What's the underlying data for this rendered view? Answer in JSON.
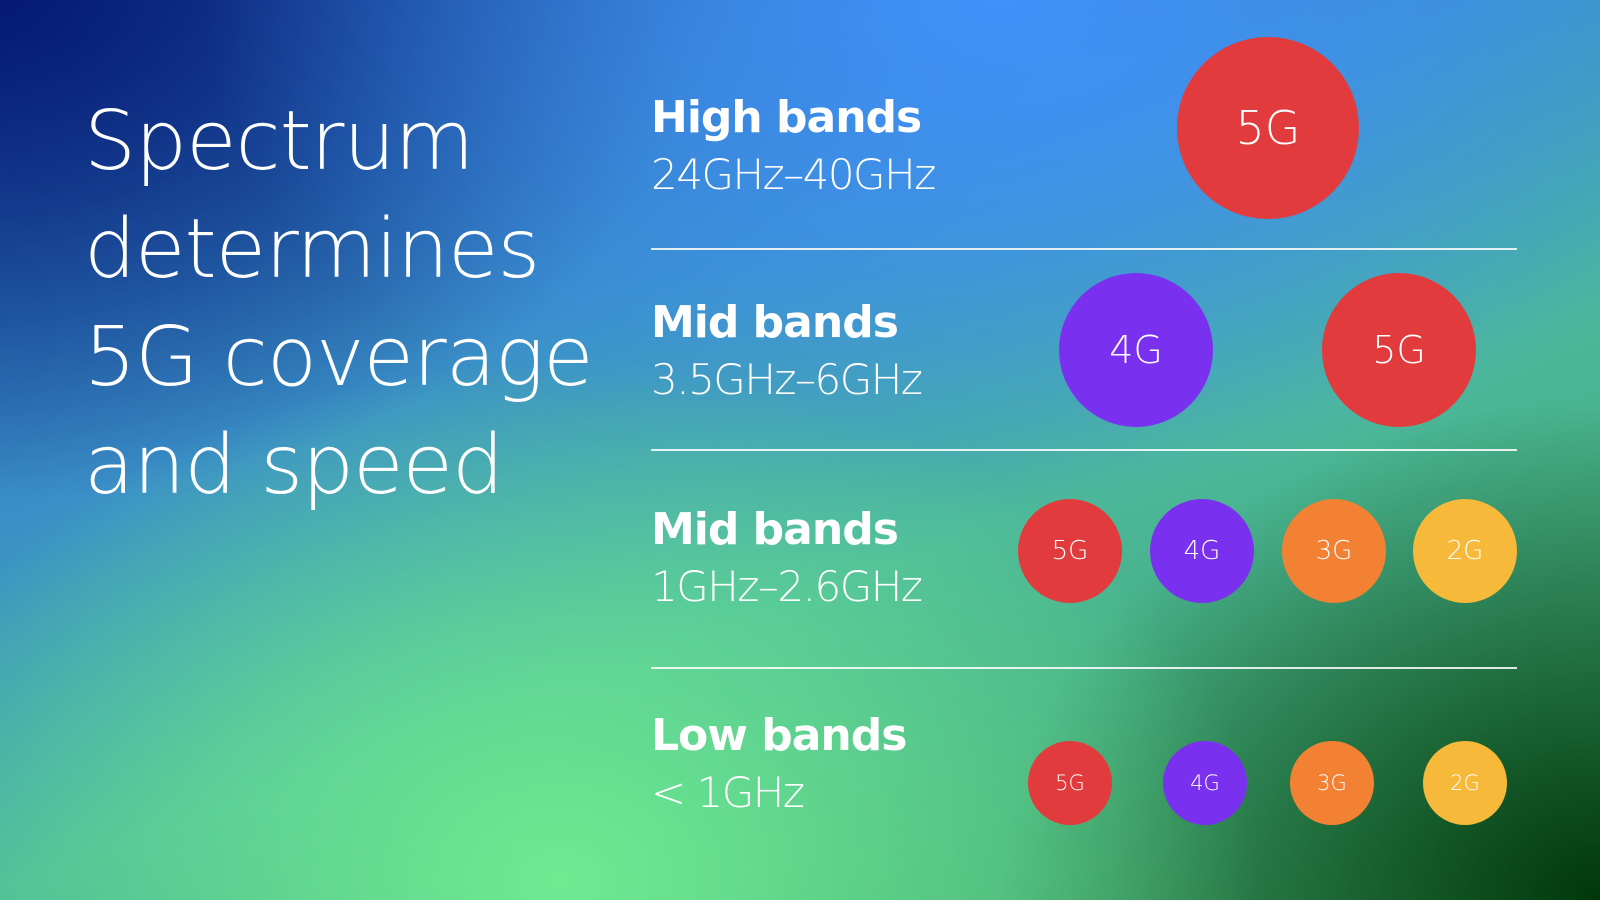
{
  "title": {
    "lines": [
      "Spectrum",
      "determines",
      "5G coverage",
      "and speed"
    ]
  },
  "colors": {
    "5G": "#e23b3d",
    "4G": "#7a30ef",
    "3G": "#f28133",
    "2G": "#f6b93a"
  },
  "bands": [
    {
      "name": "High bands",
      "range": "24GHz–40GHz",
      "technologies": [
        "5G"
      ]
    },
    {
      "name": "Mid bands",
      "range": "3.5GHz–6GHz",
      "technologies": [
        "4G",
        "5G"
      ]
    },
    {
      "name": "Mid bands",
      "range": "1GHz–2.6GHz",
      "technologies": [
        "5G",
        "4G",
        "3G",
        "2G"
      ]
    },
    {
      "name": "Low bands",
      "range": "< 1GHz",
      "technologies": [
        "5G",
        "4G",
        "3G",
        "2G"
      ]
    }
  ]
}
